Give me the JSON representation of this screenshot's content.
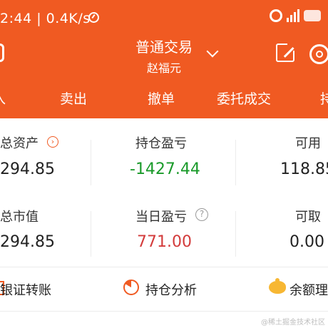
{
  "status_bar": {
    "time_speed": "2:44 | 0.4K/s"
  },
  "header": {
    "title": "普通交易",
    "subtitle": "赵福元"
  },
  "tabs": [
    "入",
    "卖出",
    "撤单",
    "委托成交",
    "持"
  ],
  "summary": {
    "total_assets": {
      "label": "总资产",
      "value": "294.85"
    },
    "position_pnl": {
      "label": "持仓盈亏",
      "value": "-1427.44"
    },
    "available": {
      "label": "可用",
      "value": "118.85"
    },
    "total_market_value": {
      "label": "总市值",
      "value": "294.85"
    },
    "today_pnl": {
      "label": "当日盈亏",
      "value": "771.00"
    },
    "withdrawable": {
      "label": "可取",
      "value": "0.00"
    }
  },
  "actions": {
    "bank_transfer": "银证转账",
    "position_analysis": "持仓分析",
    "balance_finance": "余额理"
  },
  "watermark": "@稀土掘金技术社区",
  "colors": {
    "accent": "#f05a22",
    "gain": "#d33b3b",
    "loss": "#1a9a2a"
  }
}
